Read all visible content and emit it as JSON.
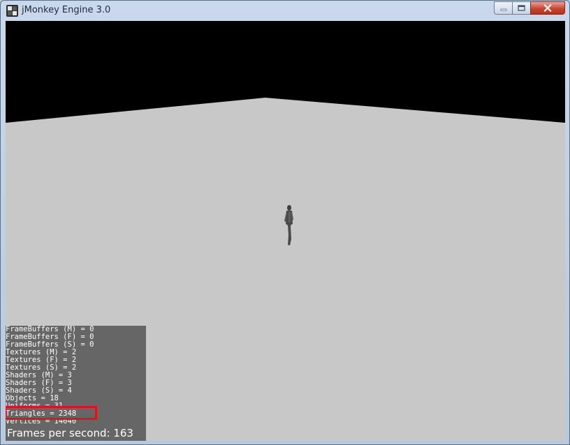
{
  "window": {
    "title": "jMonkey Engine 3.0",
    "icon": "jmonkey-app-icon",
    "controls": {
      "minimize": "minimize-icon",
      "maximize": "maximize-icon",
      "close": "close-icon"
    }
  },
  "scene": {
    "sky_color": "#000000",
    "ground_color": "#c8c8c8",
    "figure": "character-model"
  },
  "stats": {
    "lines": [
      "FrameBuffers (M) = 0",
      "FrameBuffers (F) = 0",
      "FrameBuffers (S) = 0",
      "Textures (M) = 2",
      "Textures (F) = 2",
      "Textures (S) = 2",
      "Shaders (M) = 3",
      "Shaders (F) = 3",
      "Shaders (S) = 4",
      "Objects = 18",
      "Uniforms = 31",
      "Triangles = 2348",
      "Vertices = 14640"
    ],
    "fps_label": "Frames per second: 163",
    "highlighted_line": "Triangles = 2348",
    "highlight_color": "#e0121a",
    "panel_color": "#666666"
  }
}
